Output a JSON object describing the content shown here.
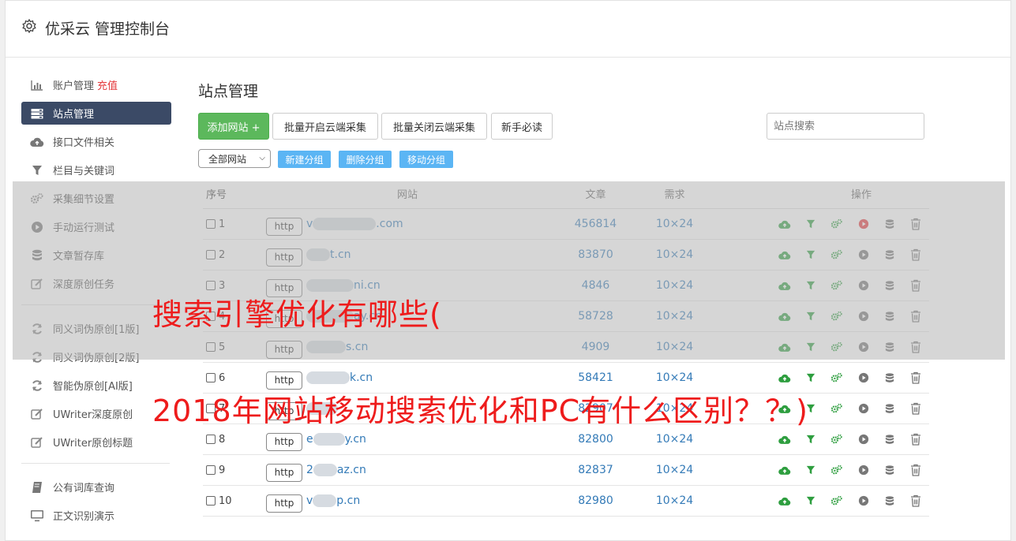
{
  "header": {
    "title": "优采云 管理控制台"
  },
  "sidebar": {
    "items": [
      {
        "label": "账户管理",
        "extra": "充值",
        "icon": "bar-chart-icon"
      },
      {
        "label": "站点管理",
        "icon": "server-icon",
        "active": true
      },
      {
        "label": "接口文件相关",
        "icon": "cloud-upload-icon"
      },
      {
        "label": "栏目与关键词",
        "icon": "filter-icon"
      },
      {
        "label": "采集细节设置",
        "icon": "cogs-icon"
      },
      {
        "label": "手动运行测试",
        "icon": "play-icon"
      },
      {
        "label": "文章暂存库",
        "icon": "database-icon"
      },
      {
        "label": "深度原创任务",
        "icon": "edit-icon"
      }
    ],
    "items2": [
      {
        "label": "同义词伪原创[1版]",
        "icon": "refresh-icon"
      },
      {
        "label": "同义词伪原创[2版]",
        "icon": "refresh-icon"
      },
      {
        "label": "智能伪原创[AI版]",
        "icon": "refresh-icon"
      },
      {
        "label": "UWriter深度原创",
        "icon": "edit-icon"
      },
      {
        "label": "UWriter原创标题",
        "icon": "edit-icon"
      }
    ],
    "items3": [
      {
        "label": "公有词库查询",
        "icon": "book-icon"
      },
      {
        "label": "正文识别演示",
        "icon": "monitor-icon"
      }
    ]
  },
  "main": {
    "title": "站点管理",
    "buttons": {
      "add": "添加网站 +",
      "batch_open": "批量开启云端采集",
      "batch_close": "批量关闭云端采集",
      "guide": "新手必读"
    },
    "search_placeholder": "站点搜索",
    "group_select": "全部网站",
    "group_buttons": {
      "new": "新建分组",
      "delete": "删除分组",
      "move": "移动分组"
    },
    "table": {
      "headers": {
        "no": "序号",
        "site": "网站",
        "articles": "文章",
        "demand": "需求",
        "ops": "操作"
      },
      "rows": [
        {
          "no": "1",
          "proto": "http",
          "prefix": "v",
          "suffix": ".com",
          "articles": "456814",
          "demand": "10×24",
          "playing": true
        },
        {
          "no": "2",
          "proto": "http",
          "prefix": "",
          "suffix": "t.cn",
          "articles": "83870",
          "demand": "10×24",
          "playing": false
        },
        {
          "no": "3",
          "proto": "http",
          "prefix": "",
          "suffix": "ni.cn",
          "articles": "4846",
          "demand": "10×24",
          "playing": false
        },
        {
          "no": "4",
          "proto": "http",
          "prefix": "",
          "suffix": "ay.cn",
          "articles": "58728",
          "demand": "10×24",
          "playing": false
        },
        {
          "no": "5",
          "proto": "http",
          "prefix": "",
          "suffix": "s.cn",
          "articles": "4909",
          "demand": "10×24",
          "playing": false
        },
        {
          "no": "6",
          "proto": "http",
          "prefix": "",
          "suffix": "k.cn",
          "articles": "58421",
          "demand": "10×24",
          "playing": false
        },
        {
          "no": "7",
          "proto": "http",
          "prefix": "",
          "suffix": "",
          "articles": "82907",
          "demand": "10×24",
          "playing": false
        },
        {
          "no": "8",
          "proto": "http",
          "prefix": "e",
          "suffix": "y.cn",
          "articles": "82800",
          "demand": "10×24",
          "playing": false
        },
        {
          "no": "9",
          "proto": "http",
          "prefix": "2",
          "suffix": "az.cn",
          "articles": "82837",
          "demand": "10×24",
          "playing": false
        },
        {
          "no": "10",
          "proto": "http",
          "prefix": "v",
          "suffix": "p.cn",
          "articles": "82980",
          "demand": "10×24",
          "playing": false
        }
      ]
    }
  },
  "overlay": {
    "line1": "搜索引擎优化有哪些(",
    "line2": "2018年网站移动搜索优化和PC有什么区别？？)"
  },
  "colors": {
    "accent": "#5cb85c",
    "active_nav": "#3b4a66",
    "link": "#337ab7",
    "overlay_text": "#ee1c1c",
    "group_btn": "#5bb5f4",
    "run_red": "#e4393c"
  }
}
